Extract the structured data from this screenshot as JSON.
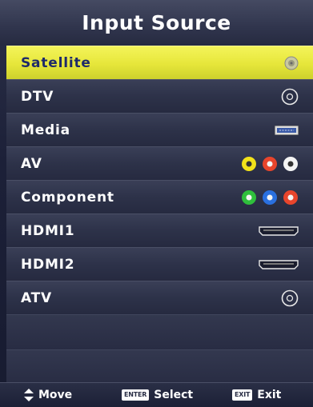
{
  "header": {
    "title": "Input Source"
  },
  "sources": [
    {
      "label": "Satellite",
      "icon": "satellite-connector-icon",
      "selected": true
    },
    {
      "label": "DTV",
      "icon": "coax-connector-icon",
      "selected": false
    },
    {
      "label": "Media",
      "icon": "usb-port-icon",
      "selected": false
    },
    {
      "label": "AV",
      "icon": "rca-av-connectors-icon",
      "selected": false
    },
    {
      "label": "Component",
      "icon": "component-connectors-icon",
      "selected": false
    },
    {
      "label": "HDMI1",
      "icon": "hdmi-port-icon",
      "selected": false
    },
    {
      "label": "HDMI2",
      "icon": "hdmi-port-icon",
      "selected": false
    },
    {
      "label": "ATV",
      "icon": "coax-connector-icon",
      "selected": false
    }
  ],
  "footer": {
    "move_label": "Move",
    "enter_key": "ENTER",
    "select_label": "Select",
    "exit_key": "EXIT",
    "exit_label": "Exit"
  },
  "colors": {
    "selected_bg": "#e6e63a",
    "selected_text": "#1e2a6a",
    "av_yellow": "#f2e21a",
    "av_red": "#e8452c",
    "av_white": "#f4f4f4",
    "comp_green": "#2fbf3c",
    "comp_blue": "#2a70e0",
    "comp_red": "#e8452c"
  }
}
